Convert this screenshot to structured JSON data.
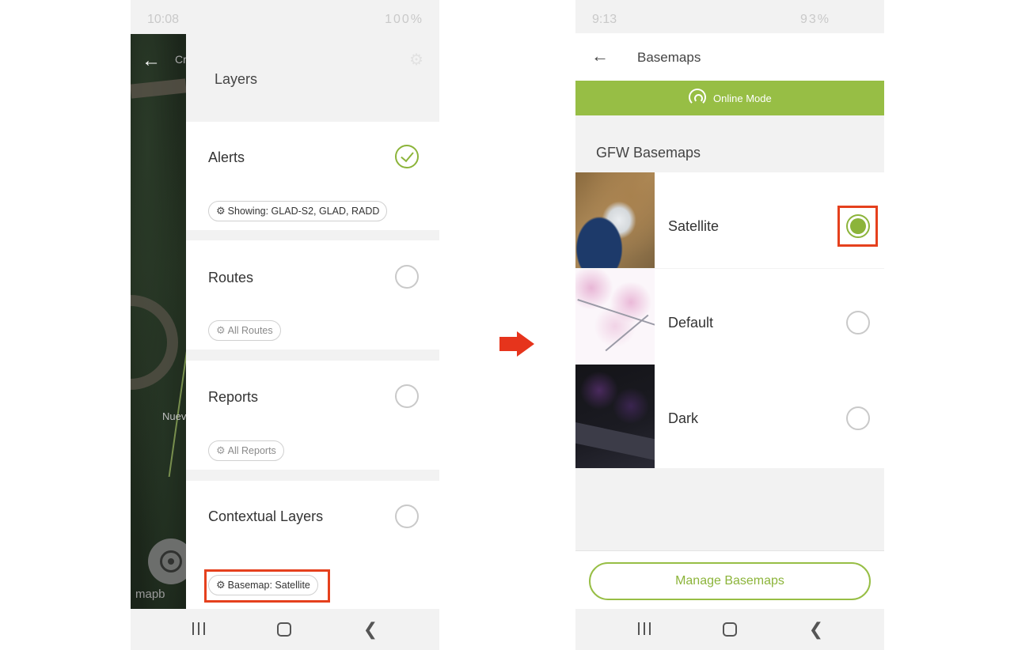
{
  "left_screen": {
    "status_bar": {
      "time": "10:08",
      "battery": "100%"
    },
    "map": {
      "back_icon": "arrow-left-icon",
      "title_fragment": "Cr",
      "place_label": "Nuev",
      "attribution": "mapb"
    },
    "panel": {
      "heading": "Layers",
      "layers": [
        {
          "name": "Alerts",
          "checked": true,
          "pill": "Showing: GLAD-S2, GLAD, RADD"
        },
        {
          "name": "Routes",
          "checked": false,
          "pill": "All Routes"
        },
        {
          "name": "Reports",
          "checked": false,
          "pill": "All Reports"
        },
        {
          "name": "Contextual Layers",
          "checked": false,
          "pill": "Basemap: Satellite"
        }
      ]
    },
    "highlight_color": "#e5401d"
  },
  "arrow_color": "#e6341c",
  "right_screen": {
    "status_bar": {
      "time": "9:13",
      "battery": "93%"
    },
    "app_bar": {
      "title": "Basemaps",
      "back_icon": "arrow-left-icon"
    },
    "online_banner": {
      "label": "Online Mode",
      "color": "#97be45"
    },
    "section_title": "GFW Basemaps",
    "basemaps": [
      {
        "name": "Satellite",
        "selected": true
      },
      {
        "name": "Default",
        "selected": false
      },
      {
        "name": "Dark",
        "selected": false
      }
    ],
    "manage_button": "Manage Basemaps",
    "accent": "#8cb43a"
  }
}
